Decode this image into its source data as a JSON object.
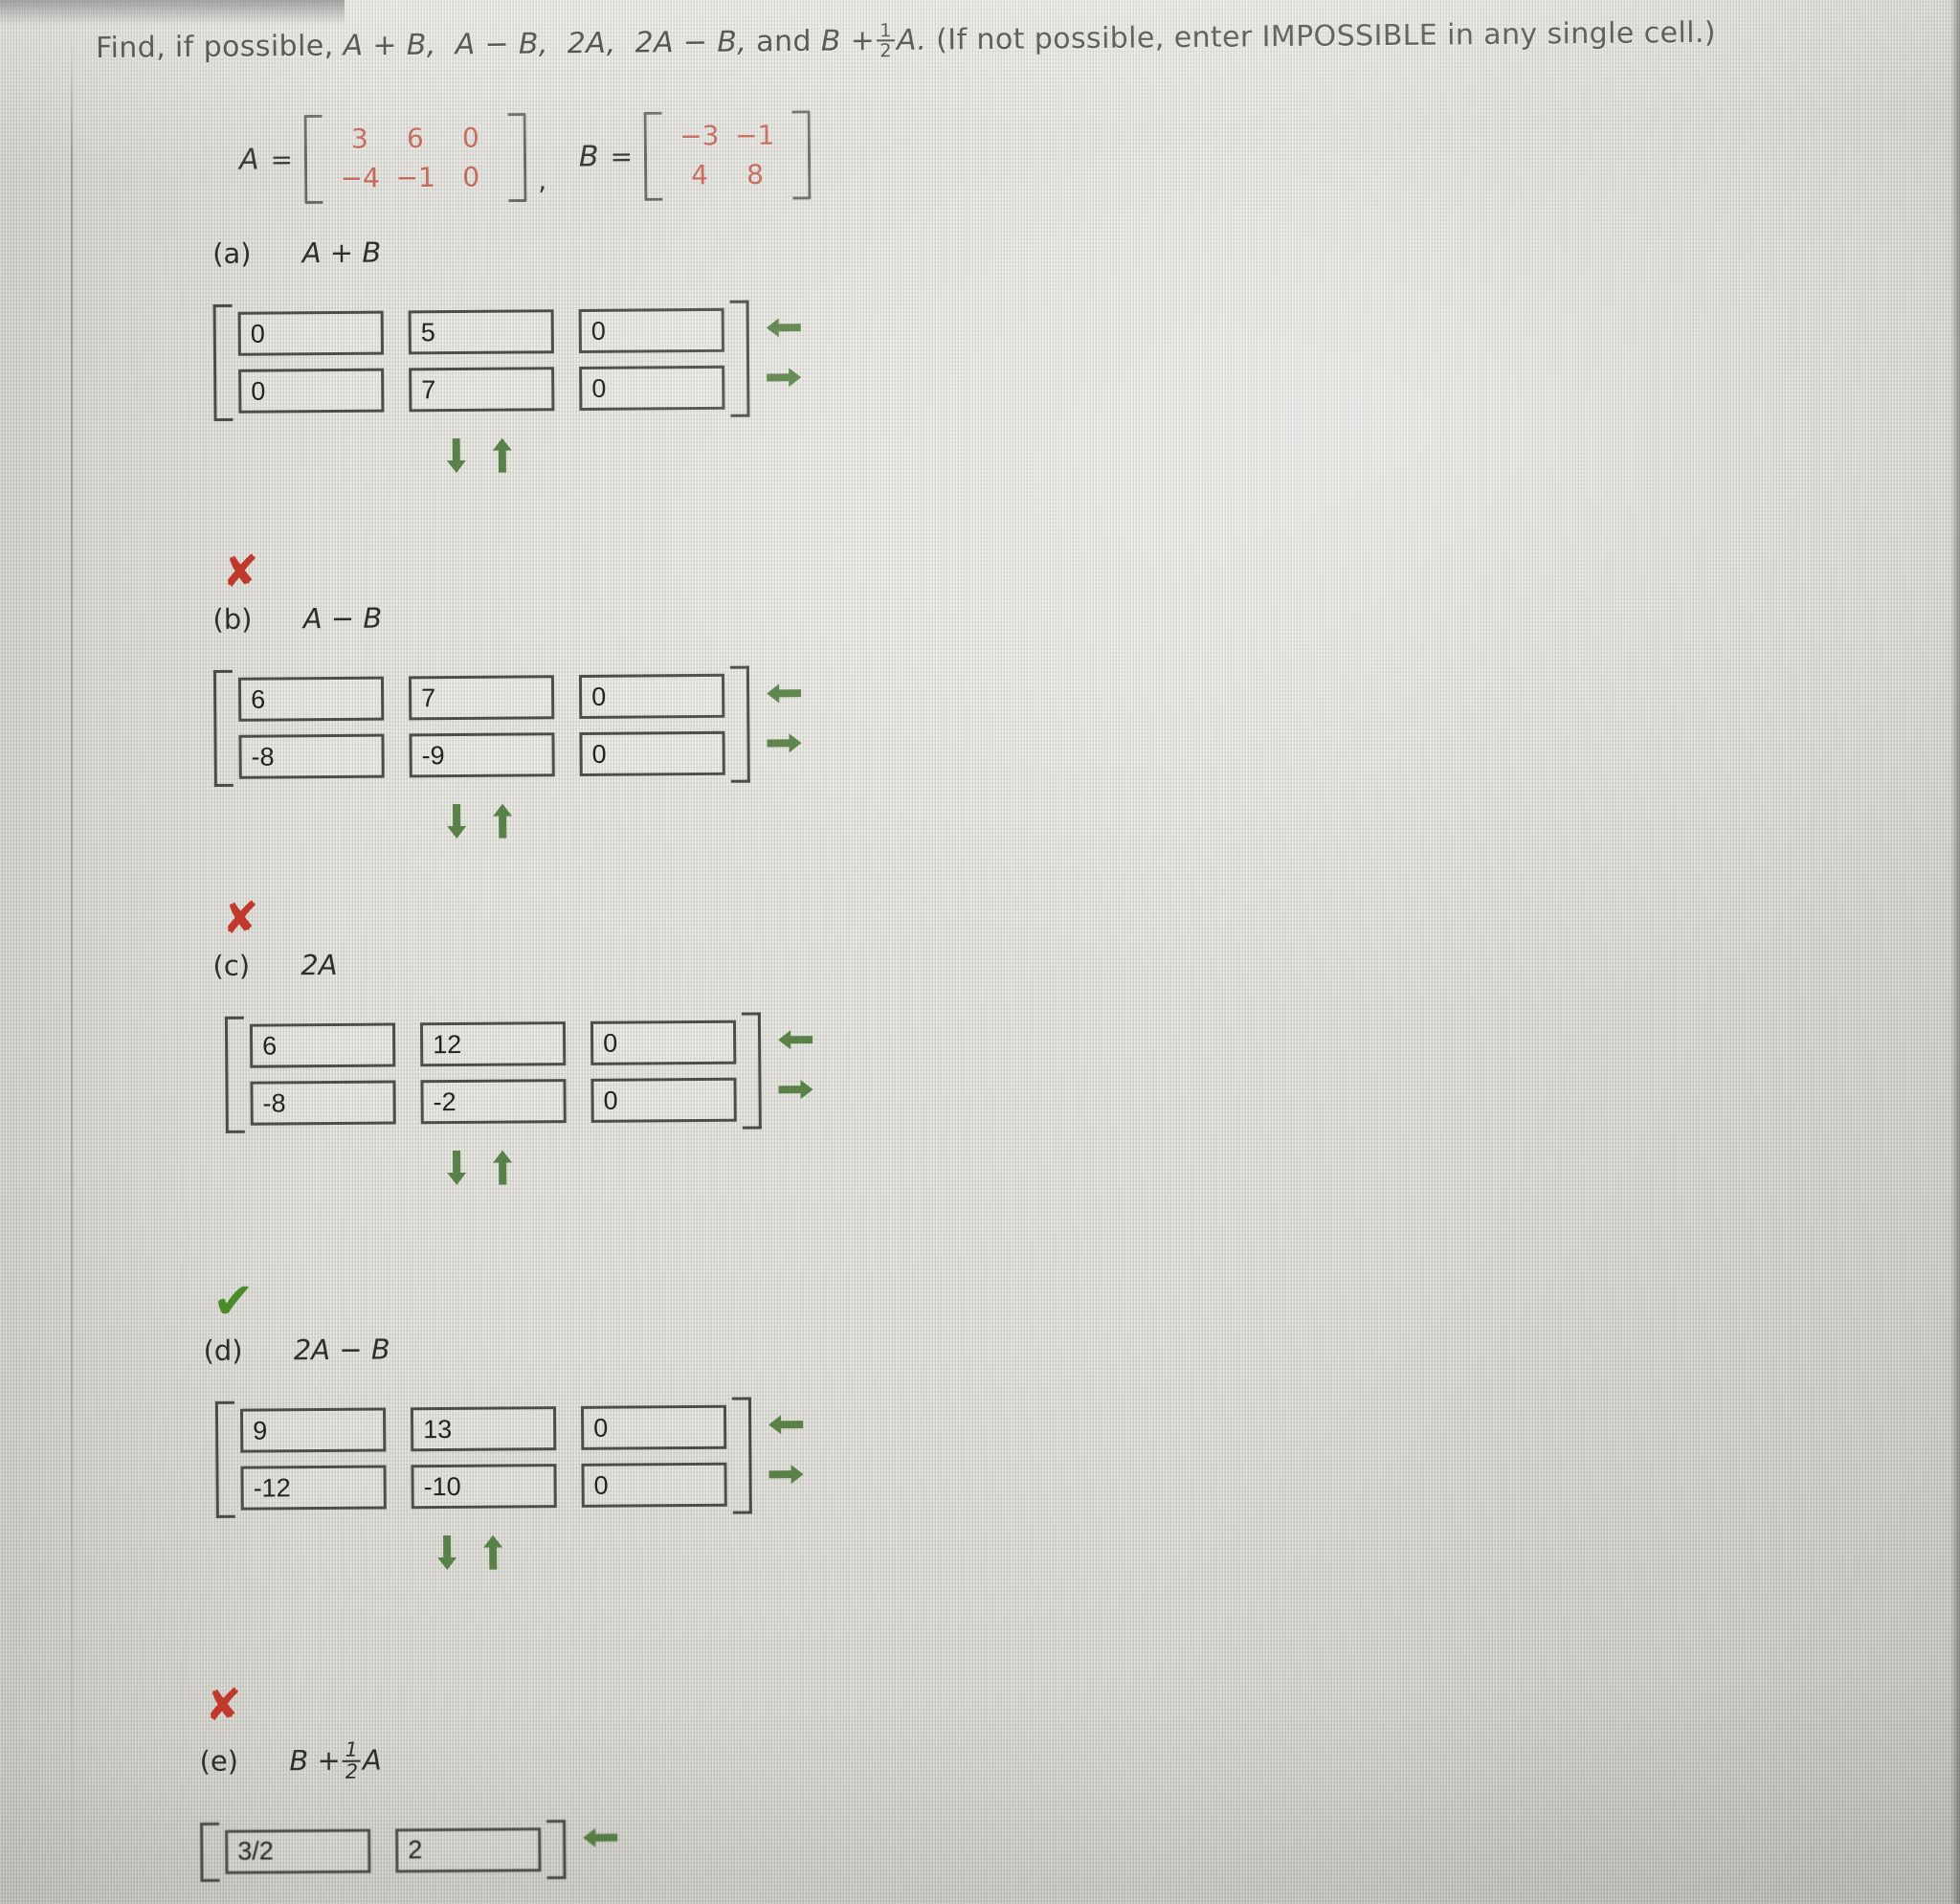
{
  "prompt": {
    "lead": "Find, if possible,",
    "expr1": "A + B,",
    "expr2": "A − B,",
    "expr3": "2A,",
    "expr4": "2A − B,",
    "conj": "and",
    "expr5_lead": "B +",
    "frac_num": "1",
    "frac_den": "2",
    "expr5_tail": "A.",
    "note": "(If not possible, enter IMPOSSIBLE in any single cell.)"
  },
  "givens": {
    "a_label": "A",
    "b_label": "B",
    "equals": "=",
    "comma": ",",
    "matrix_a": [
      [
        "3",
        "6",
        "0"
      ],
      [
        "−4",
        "−1",
        "0"
      ]
    ],
    "matrix_b": [
      [
        "−3",
        "−1"
      ],
      [
        "4",
        "8"
      ]
    ],
    "entry_color": "#c4695c"
  },
  "icons": {
    "wrong": "✘",
    "correct": "✔",
    "left_arrow": "left-arrow-icon",
    "right_arrow": "right-arrow-icon",
    "down_arrow": "down-arrow-icon",
    "up_arrow": "up-arrow-icon",
    "arrow_color": "#4f7a3c"
  },
  "parts": [
    {
      "id": "a",
      "label": "(a)",
      "expr": "A + B",
      "mark": "none",
      "values": [
        [
          "0",
          "5",
          "0"
        ],
        [
          "0",
          "7",
          "0"
        ]
      ]
    },
    {
      "id": "b",
      "label": "(b)",
      "expr": "A − B",
      "mark": "wrong",
      "values": [
        [
          "6",
          "7",
          "0"
        ],
        [
          "-8",
          "-9",
          "0"
        ]
      ]
    },
    {
      "id": "c",
      "label": "(c)",
      "expr": "2A",
      "mark": "wrong",
      "values": [
        [
          "6",
          "12",
          "0"
        ],
        [
          "-8",
          "-2",
          "0"
        ]
      ]
    },
    {
      "id": "d",
      "label": "(d)",
      "expr": "2A − B",
      "mark": "correct",
      "values": [
        [
          "9",
          "13",
          "0"
        ],
        [
          "-12",
          "-10",
          "0"
        ]
      ]
    },
    {
      "id": "e",
      "label": "(e)",
      "expr_lead": "B +",
      "expr_frac_num": "1",
      "expr_frac_den": "2",
      "expr_tail": "A",
      "mark": "wrong",
      "values": [
        [
          "3/2",
          "2"
        ]
      ]
    }
  ]
}
